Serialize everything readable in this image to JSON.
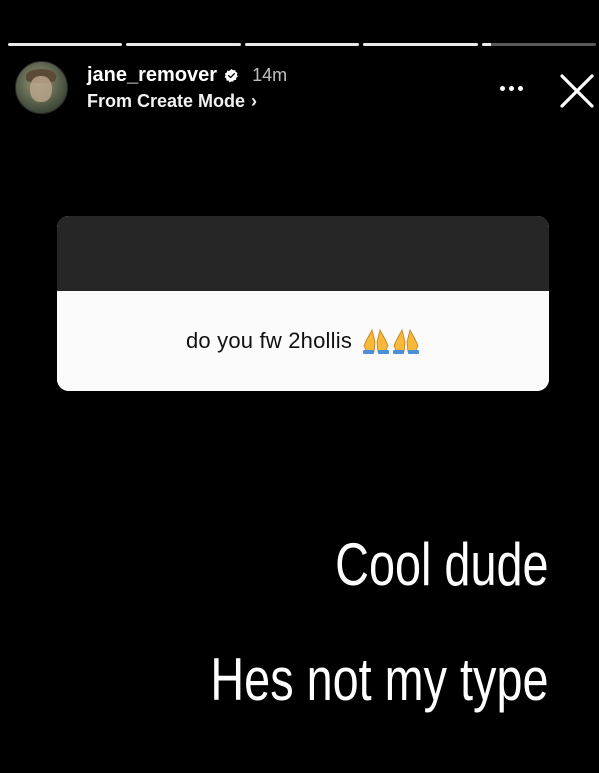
{
  "story": {
    "progress": [
      1,
      1,
      1,
      1,
      0.08
    ]
  },
  "header": {
    "username": "jane_remover",
    "time_ago": "14m",
    "subtitle": "From Create Mode",
    "subtitle_chevron": "›",
    "icons": {
      "verified": "verified-badge-icon",
      "more": "more-options-icon",
      "close": "close-icon"
    }
  },
  "question_sticker": {
    "question": "do you fw 2hollis",
    "emoji": "🙏🙏"
  },
  "reply": {
    "line1": "Cool dude",
    "line2": "Hes not my type"
  },
  "colors": {
    "background": "#000000",
    "card_top": "#262626",
    "card_bottom": "#fbfbfb",
    "text": "#ffffff"
  }
}
